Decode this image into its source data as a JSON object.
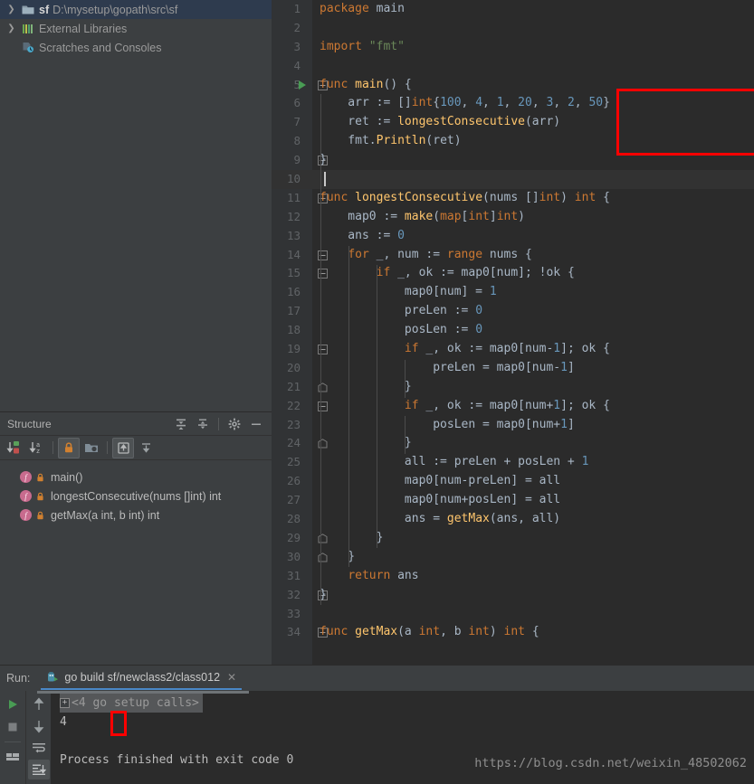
{
  "project_tree": {
    "items": [
      {
        "arrow": "chevron-right",
        "icon": "folder-icon",
        "bold": "sf",
        "dim": "D:\\mysetup\\gopath\\src\\sf",
        "selected": true
      },
      {
        "arrow": "chevron-right",
        "icon": "library-bars-icon",
        "bold": "",
        "dim": "External Libraries",
        "label": "External Libraries",
        "selected": false
      },
      {
        "arrow": "",
        "icon": "scratches-clock-icon",
        "bold": "",
        "dim": "Scratches and Consoles",
        "label": "Scratches and Consoles",
        "selected": false
      }
    ]
  },
  "structure": {
    "title": "Structure",
    "header_icons": [
      "expand-all-icon",
      "collapse-all-icon",
      "gear-icon",
      "minimize-icon"
    ],
    "toolbar_icons": [
      "sort-by-visibility-icon",
      "sort-alphabetically-icon",
      "show-non-public-icon",
      "group-by-file-icon",
      "show-inherited-icon",
      "show-anonymous-icon"
    ],
    "items": [
      {
        "icon": "function-icon",
        "lock": "lock-icon",
        "label": "main()"
      },
      {
        "icon": "function-icon",
        "lock": "lock-icon",
        "label": "longestConsecutive(nums []int) int"
      },
      {
        "icon": "function-icon",
        "lock": "lock-icon",
        "label": "getMax(a int, b int) int"
      }
    ]
  },
  "editor": {
    "language": "go",
    "caret_line": 10,
    "run_marker_line": 5,
    "highlight_box": {
      "from_line": 6,
      "to_line": 8,
      "color": "#ff0000"
    },
    "lines": [
      {
        "n": 1,
        "fold": "",
        "tokens": [
          [
            "kw",
            "package"
          ],
          [
            "idn",
            " main"
          ]
        ]
      },
      {
        "n": 2,
        "fold": "",
        "tokens": []
      },
      {
        "n": 3,
        "fold": "",
        "tokens": [
          [
            "kw",
            "import"
          ],
          [
            "idn",
            " "
          ],
          [
            "str",
            "\"fmt\""
          ]
        ]
      },
      {
        "n": 4,
        "fold": "",
        "tokens": []
      },
      {
        "n": 5,
        "fold": "-",
        "tokens": [
          [
            "kw",
            "func"
          ],
          [
            "idn",
            " "
          ],
          [
            "fn",
            "main"
          ],
          [
            "idn",
            "() {"
          ]
        ]
      },
      {
        "n": 6,
        "fold": "",
        "tokens": [
          [
            "idn",
            "    arr := []"
          ],
          [
            "kw",
            "int"
          ],
          [
            "idn",
            "{"
          ],
          [
            "num",
            "100"
          ],
          [
            "idn",
            ", "
          ],
          [
            "num",
            "4"
          ],
          [
            "idn",
            ", "
          ],
          [
            "num",
            "1"
          ],
          [
            "idn",
            ", "
          ],
          [
            "num",
            "20"
          ],
          [
            "idn",
            ", "
          ],
          [
            "num",
            "3"
          ],
          [
            "idn",
            ", "
          ],
          [
            "num",
            "2"
          ],
          [
            "idn",
            ", "
          ],
          [
            "num",
            "50"
          ],
          [
            "idn",
            "}"
          ]
        ]
      },
      {
        "n": 7,
        "fold": "",
        "tokens": [
          [
            "idn",
            "    ret := "
          ],
          [
            "fn",
            "longestConsecutive"
          ],
          [
            "idn",
            "(arr)"
          ]
        ]
      },
      {
        "n": 8,
        "fold": "",
        "tokens": [
          [
            "idn",
            "    fmt."
          ],
          [
            "fn",
            "Println"
          ],
          [
            "idn",
            "(ret)"
          ]
        ]
      },
      {
        "n": 9,
        "fold": "-",
        "tokens": [
          [
            "idn",
            "}"
          ]
        ]
      },
      {
        "n": 10,
        "fold": "",
        "tokens": []
      },
      {
        "n": 11,
        "fold": "-",
        "tokens": [
          [
            "kw",
            "func"
          ],
          [
            "idn",
            " "
          ],
          [
            "fn",
            "longestConsecutive"
          ],
          [
            "idn",
            "(nums []"
          ],
          [
            "kw",
            "int"
          ],
          [
            "idn",
            ") "
          ],
          [
            "kw",
            "int"
          ],
          [
            "idn",
            " {"
          ]
        ]
      },
      {
        "n": 12,
        "fold": "",
        "tokens": [
          [
            "idn",
            "    map0 := "
          ],
          [
            "fn",
            "make"
          ],
          [
            "idn",
            "("
          ],
          [
            "kw",
            "map"
          ],
          [
            "idn",
            "["
          ],
          [
            "kw",
            "int"
          ],
          [
            "idn",
            "]"
          ],
          [
            "kw",
            "int"
          ],
          [
            "idn",
            ")"
          ]
        ]
      },
      {
        "n": 13,
        "fold": "",
        "tokens": [
          [
            "idn",
            "    ans := "
          ],
          [
            "num",
            "0"
          ]
        ]
      },
      {
        "n": 14,
        "fold": "-",
        "tokens": [
          [
            "idn",
            "    "
          ],
          [
            "kw",
            "for"
          ],
          [
            "idn",
            " _, num := "
          ],
          [
            "kw",
            "range"
          ],
          [
            "idn",
            " nums {"
          ]
        ]
      },
      {
        "n": 15,
        "fold": "-",
        "tokens": [
          [
            "idn",
            "        "
          ],
          [
            "kw",
            "if"
          ],
          [
            "idn",
            " _, ok := map0[num]; !ok {"
          ]
        ]
      },
      {
        "n": 16,
        "fold": "",
        "tokens": [
          [
            "idn",
            "            map0[num] = "
          ],
          [
            "num",
            "1"
          ]
        ]
      },
      {
        "n": 17,
        "fold": "",
        "tokens": [
          [
            "idn",
            "            preLen := "
          ],
          [
            "num",
            "0"
          ]
        ]
      },
      {
        "n": 18,
        "fold": "",
        "tokens": [
          [
            "idn",
            "            posLen := "
          ],
          [
            "num",
            "0"
          ]
        ]
      },
      {
        "n": 19,
        "fold": "-",
        "tokens": [
          [
            "idn",
            "            "
          ],
          [
            "kw",
            "if"
          ],
          [
            "idn",
            " _, ok := map0[num-"
          ],
          [
            "num",
            "1"
          ],
          [
            "idn",
            "]; ok {"
          ]
        ]
      },
      {
        "n": 20,
        "fold": "",
        "tokens": [
          [
            "idn",
            "                preLen = map0[num-"
          ],
          [
            "num",
            "1"
          ],
          [
            "idn",
            "]"
          ]
        ]
      },
      {
        "n": 21,
        "fold": "^",
        "tokens": [
          [
            "idn",
            "            }"
          ]
        ]
      },
      {
        "n": 22,
        "fold": "-",
        "tokens": [
          [
            "idn",
            "            "
          ],
          [
            "kw",
            "if"
          ],
          [
            "idn",
            " _, ok := map0[num+"
          ],
          [
            "num",
            "1"
          ],
          [
            "idn",
            "]; ok {"
          ]
        ]
      },
      {
        "n": 23,
        "fold": "",
        "tokens": [
          [
            "idn",
            "                posLen = map0[num+"
          ],
          [
            "num",
            "1"
          ],
          [
            "idn",
            "]"
          ]
        ]
      },
      {
        "n": 24,
        "fold": "^",
        "tokens": [
          [
            "idn",
            "            }"
          ]
        ]
      },
      {
        "n": 25,
        "fold": "",
        "tokens": [
          [
            "idn",
            "            all := preLen + posLen + "
          ],
          [
            "num",
            "1"
          ]
        ]
      },
      {
        "n": 26,
        "fold": "",
        "tokens": [
          [
            "idn",
            "            map0[num-preLen] = all"
          ]
        ]
      },
      {
        "n": 27,
        "fold": "",
        "tokens": [
          [
            "idn",
            "            map0[num+posLen] = all"
          ]
        ]
      },
      {
        "n": 28,
        "fold": "",
        "tokens": [
          [
            "idn",
            "            ans = "
          ],
          [
            "fn",
            "getMax"
          ],
          [
            "idn",
            "(ans, all)"
          ]
        ]
      },
      {
        "n": 29,
        "fold": "^",
        "tokens": [
          [
            "idn",
            "        }"
          ]
        ]
      },
      {
        "n": 30,
        "fold": "^",
        "tokens": [
          [
            "idn",
            "    }"
          ]
        ]
      },
      {
        "n": 31,
        "fold": "",
        "tokens": [
          [
            "idn",
            "    "
          ],
          [
            "kw",
            "return"
          ],
          [
            "idn",
            " ans"
          ]
        ]
      },
      {
        "n": 32,
        "fold": "-",
        "tokens": [
          [
            "idn",
            "}"
          ]
        ]
      },
      {
        "n": 33,
        "fold": "",
        "tokens": []
      },
      {
        "n": 34,
        "fold": "-",
        "tokens": [
          [
            "kw",
            "func"
          ],
          [
            "idn",
            " "
          ],
          [
            "fn",
            "getMax"
          ],
          [
            "idn",
            "(a "
          ],
          [
            "kw",
            "int"
          ],
          [
            "idn",
            ", b "
          ],
          [
            "kw",
            "int"
          ],
          [
            "idn",
            ") "
          ],
          [
            "kw",
            "int"
          ],
          [
            "idn",
            " {"
          ]
        ]
      }
    ]
  },
  "run_panel": {
    "label": "Run:",
    "tab_title": "go build sf/newclass2/class012",
    "tab_icon": "go-run-config-icon",
    "close_icon": "close-icon",
    "toolbar_left": [
      "rerun-icon",
      "stop-icon",
      "layout-icon"
    ],
    "toolbar_right": [
      "up-arrow-icon",
      "down-arrow-icon",
      "soft-wrap-icon",
      "scroll-to-end-icon"
    ],
    "console": {
      "setup_calls": "<4 go setup calls>",
      "output": "4",
      "finished": "Process finished with exit code 0",
      "highlight_output": true
    }
  },
  "watermark": "https://blog.csdn.net/weixin_48502062",
  "colors": {
    "editor_bg": "#2b2b2b",
    "panel_bg": "#3c3f41",
    "gutter_bg": "#313335",
    "selection_blue": "#2e3b4e",
    "keyword": "#cc7832",
    "function": "#ffc66d",
    "number": "#6897bb",
    "string": "#6a8759",
    "identifier": "#a9b7c6",
    "highlight_red": "#ff0000",
    "tab_underline": "#4a88c7"
  }
}
